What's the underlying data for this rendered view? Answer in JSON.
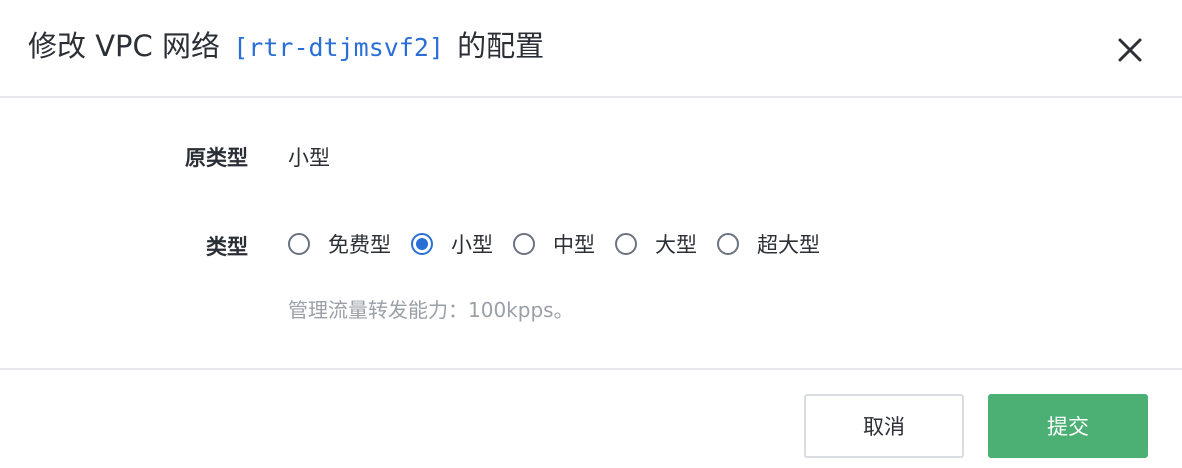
{
  "dialog": {
    "title_prefix": "修改 VPC 网络",
    "title_code": "[rtr-dtjmsvf2]",
    "title_suffix": "的配置",
    "close_icon": "close-icon"
  },
  "form": {
    "original_type_label": "原类型",
    "original_type_value": "小型",
    "type_label": "类型",
    "type_options": [
      {
        "label": "免费型",
        "checked": false
      },
      {
        "label": "小型",
        "checked": true
      },
      {
        "label": "中型",
        "checked": false
      },
      {
        "label": "大型",
        "checked": false
      },
      {
        "label": "超大型",
        "checked": false
      }
    ],
    "hint": "管理流量转发能力：100kpps。"
  },
  "footer": {
    "cancel_label": "取消",
    "submit_label": "提交"
  },
  "colors": {
    "accent": "#2a6fd6",
    "submit": "#4caf73",
    "hint": "#9aa0a8"
  }
}
